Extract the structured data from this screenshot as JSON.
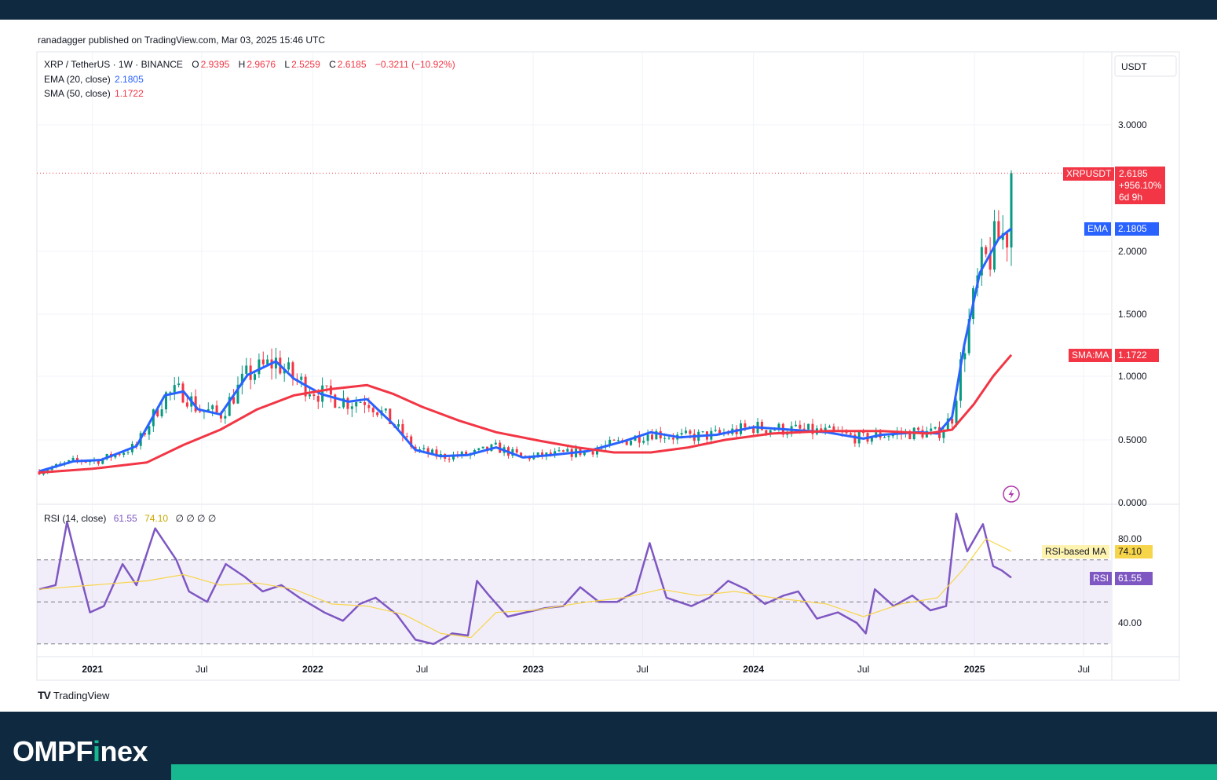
{
  "header": {
    "published": "ranadagger published on TradingView.com, Mar 03, 2025 15:46 UTC"
  },
  "symbol_legend": {
    "symbol": "XRP / TetherUS · 1W · BINANCE",
    "o_label": "O",
    "o_value": "2.9395",
    "h_label": "H",
    "h_value": "2.9676",
    "l_label": "L",
    "l_value": "2.5259",
    "c_label": "C",
    "c_value": "2.6185",
    "change": "−0.3211 (−10.92%)",
    "ema_label": "EMA (20, close)",
    "ema_value": "2.1805",
    "sma_label": "SMA (50, close)",
    "sma_value": "1.1722"
  },
  "price_axis": {
    "currency": "USDT",
    "ticks": [
      "3.0000",
      "2.0000",
      "1.5000",
      "1.0000",
      "0.5000",
      "0.0000"
    ]
  },
  "price_labels": {
    "symbol_tag": "XRPUSDT",
    "last_price": "2.6185",
    "pct_change": "+956.10%",
    "countdown": "6d 9h",
    "ema_tag": "EMA",
    "ema_value": "2.1805",
    "sma_tag": "SMA:MA",
    "sma_value": "1.1722"
  },
  "rsi_legend": {
    "label": "RSI (14, close)",
    "rsi_value": "61.55",
    "ma_value": "74.10",
    "extras": "∅ ∅ ∅ ∅"
  },
  "rsi_axis": {
    "ticks": [
      "80.00",
      "40.00"
    ],
    "ma_tag": "RSI-based MA",
    "ma_value": "74.10",
    "rsi_tag": "RSI",
    "rsi_value": "61.55"
  },
  "time_axis": [
    "2021",
    "Jul",
    "2022",
    "Jul",
    "2023",
    "Jul",
    "2024",
    "Jul",
    "2025",
    "Jul"
  ],
  "footer": {
    "tv_logo": "TradingView",
    "brand_a": "OMPF",
    "brand_i": "i",
    "brand_b": "nex"
  },
  "colors": {
    "up": "#089981",
    "down": "#f23645",
    "ema": "#2962ff",
    "sma": "#f23645",
    "rsi": "#7e57c2",
    "rsi_ma": "#f7d54a",
    "band": "#0f2a40",
    "accent": "#17b890"
  },
  "chart_data": [
    {
      "type": "line",
      "title": "XRP / TetherUS · 1W · BINANCE",
      "xlabel": "",
      "ylabel": "",
      "ylim": [
        0,
        3.5
      ],
      "x_range": [
        "2020-10",
        "2025-09"
      ],
      "series": [
        {
          "name": "EMA (20, close)",
          "color": "#2962ff",
          "points": [
            [
              "2020-10-05",
              0.25
            ],
            [
              "2020-12-01",
              0.33
            ],
            [
              "2021-01-15",
              0.34
            ],
            [
              "2021-03-15",
              0.45
            ],
            [
              "2021-05-01",
              0.85
            ],
            [
              "2021-06-01",
              0.88
            ],
            [
              "2021-06-25",
              0.74
            ],
            [
              "2021-08-01",
              0.7
            ],
            [
              "2021-09-15",
              1.01
            ],
            [
              "2021-11-01",
              1.12
            ],
            [
              "2021-12-01",
              0.98
            ],
            [
              "2022-01-15",
              0.86
            ],
            [
              "2022-03-01",
              0.8
            ],
            [
              "2022-04-01",
              0.82
            ],
            [
              "2022-05-15",
              0.62
            ],
            [
              "2022-06-20",
              0.42
            ],
            [
              "2022-08-01",
              0.37
            ],
            [
              "2022-09-15",
              0.38
            ],
            [
              "2022-11-01",
              0.44
            ],
            [
              "2022-12-15",
              0.36
            ],
            [
              "2023-02-01",
              0.38
            ],
            [
              "2023-04-01",
              0.41
            ],
            [
              "2023-06-01",
              0.49
            ],
            [
              "2023-07-15",
              0.56
            ],
            [
              "2023-09-01",
              0.52
            ],
            [
              "2023-11-01",
              0.54
            ],
            [
              "2024-01-01",
              0.6
            ],
            [
              "2024-03-01",
              0.58
            ],
            [
              "2024-05-01",
              0.56
            ],
            [
              "2024-07-01",
              0.51
            ],
            [
              "2024-08-01",
              0.54
            ],
            [
              "2024-10-01",
              0.56
            ],
            [
              "2024-11-01",
              0.55
            ],
            [
              "2024-11-25",
              0.68
            ],
            [
              "2024-12-15",
              1.25
            ],
            [
              "2025-01-10",
              1.83
            ],
            [
              "2025-02-10",
              2.1
            ],
            [
              "2025-03-03",
              2.1805
            ]
          ]
        },
        {
          "name": "SMA (50, close)",
          "color": "#f23645",
          "points": [
            [
              "2020-10-05",
              0.24
            ],
            [
              "2021-01-01",
              0.27
            ],
            [
              "2021-04-01",
              0.32
            ],
            [
              "2021-06-01",
              0.46
            ],
            [
              "2021-08-01",
              0.58
            ],
            [
              "2021-10-01",
              0.74
            ],
            [
              "2021-12-01",
              0.85
            ],
            [
              "2022-02-01",
              0.9
            ],
            [
              "2022-04-01",
              0.93
            ],
            [
              "2022-05-15",
              0.86
            ],
            [
              "2022-07-01",
              0.76
            ],
            [
              "2022-09-01",
              0.65
            ],
            [
              "2022-11-01",
              0.56
            ],
            [
              "2023-01-15",
              0.49
            ],
            [
              "2023-03-15",
              0.44
            ],
            [
              "2023-05-15",
              0.4
            ],
            [
              "2023-07-15",
              0.4
            ],
            [
              "2023-09-15",
              0.44
            ],
            [
              "2023-11-15",
              0.5
            ],
            [
              "2024-02-01",
              0.55
            ],
            [
              "2024-05-01",
              0.57
            ],
            [
              "2024-08-01",
              0.57
            ],
            [
              "2024-10-15",
              0.55
            ],
            [
              "2024-11-25",
              0.58
            ],
            [
              "2024-12-31",
              0.78
            ],
            [
              "2025-02-01",
              1.0
            ],
            [
              "2025-03-03",
              1.1722
            ]
          ]
        }
      ],
      "last_close": 2.6185
    },
    {
      "type": "line",
      "title": "RSI (14, close)",
      "ylim": [
        25,
        95
      ],
      "bands": {
        "upper": 70,
        "middle": 50,
        "lower": 30
      },
      "series": [
        {
          "name": "RSI",
          "color": "#7e57c2",
          "points": [
            [
              "2020-10-05",
              56
            ],
            [
              "2020-11-01",
              58
            ],
            [
              "2020-11-20",
              88
            ],
            [
              "2020-12-10",
              65
            ],
            [
              "2020-12-28",
              45
            ],
            [
              "2021-01-20",
              48
            ],
            [
              "2021-02-20",
              68
            ],
            [
              "2021-03-15",
              58
            ],
            [
              "2021-04-15",
              85
            ],
            [
              "2021-05-20",
              70
            ],
            [
              "2021-06-10",
              55
            ],
            [
              "2021-07-10",
              50
            ],
            [
              "2021-08-10",
              68
            ],
            [
              "2021-09-10",
              62
            ],
            [
              "2021-10-10",
              55
            ],
            [
              "2021-11-10",
              58
            ],
            [
              "2021-12-10",
              52
            ],
            [
              "2022-01-20",
              45
            ],
            [
              "2022-02-20",
              41
            ],
            [
              "2022-03-20",
              49
            ],
            [
              "2022-04-15",
              52
            ],
            [
              "2022-05-20",
              44
            ],
            [
              "2022-06-20",
              32
            ],
            [
              "2022-07-20",
              30
            ],
            [
              "2022-08-20",
              35
            ],
            [
              "2022-09-15",
              34
            ],
            [
              "2022-09-30",
              60
            ],
            [
              "2022-10-20",
              53
            ],
            [
              "2022-11-20",
              43
            ],
            [
              "2022-12-20",
              45
            ],
            [
              "2023-01-20",
              47
            ],
            [
              "2023-02-20",
              48
            ],
            [
              "2023-03-20",
              57
            ],
            [
              "2023-04-20",
              50
            ],
            [
              "2023-05-20",
              50
            ],
            [
              "2023-06-20",
              55
            ],
            [
              "2023-07-13",
              78
            ],
            [
              "2023-08-10",
              52
            ],
            [
              "2023-09-20",
              48
            ],
            [
              "2023-10-20",
              52
            ],
            [
              "2023-11-20",
              60
            ],
            [
              "2023-12-20",
              56
            ],
            [
              "2024-01-20",
              49
            ],
            [
              "2024-02-20",
              53
            ],
            [
              "2024-03-15",
              55
            ],
            [
              "2024-04-15",
              42
            ],
            [
              "2024-05-20",
              45
            ],
            [
              "2024-06-20",
              40
            ],
            [
              "2024-07-05",
              35
            ],
            [
              "2024-07-20",
              56
            ],
            [
              "2024-08-20",
              48
            ],
            [
              "2024-09-20",
              53
            ],
            [
              "2024-10-20",
              46
            ],
            [
              "2024-11-15",
              48
            ],
            [
              "2024-12-02",
              92
            ],
            [
              "2024-12-20",
              74
            ],
            [
              "2025-01-15",
              87
            ],
            [
              "2025-02-01",
              67
            ],
            [
              "2025-02-15",
              65
            ],
            [
              "2025-03-03",
              61.55
            ]
          ]
        },
        {
          "name": "RSI-based MA",
          "color": "#f7d54a",
          "points": [
            [
              "2020-10-05",
              56
            ],
            [
              "2021-01-01",
              58
            ],
            [
              "2021-04-01",
              60
            ],
            [
              "2021-06-01",
              63
            ],
            [
              "2021-08-01",
              58
            ],
            [
              "2021-10-01",
              59
            ],
            [
              "2021-12-01",
              56
            ],
            [
              "2022-02-01",
              49
            ],
            [
              "2022-04-01",
              48
            ],
            [
              "2022-06-01",
              44
            ],
            [
              "2022-08-01",
              35
            ],
            [
              "2022-09-20",
              33
            ],
            [
              "2022-11-01",
              45
            ],
            [
              "2023-01-01",
              46
            ],
            [
              "2023-04-01",
              50
            ],
            [
              "2023-06-01",
              52
            ],
            [
              "2023-08-01",
              56
            ],
            [
              "2023-10-01",
              53
            ],
            [
              "2023-12-01",
              55
            ],
            [
              "2024-02-01",
              52
            ],
            [
              "2024-05-01",
              49
            ],
            [
              "2024-07-01",
              43
            ],
            [
              "2024-09-01",
              49
            ],
            [
              "2024-11-01",
              52
            ],
            [
              "2024-12-15",
              66
            ],
            [
              "2025-01-20",
              80
            ],
            [
              "2025-03-03",
              74.1
            ]
          ]
        }
      ]
    }
  ]
}
